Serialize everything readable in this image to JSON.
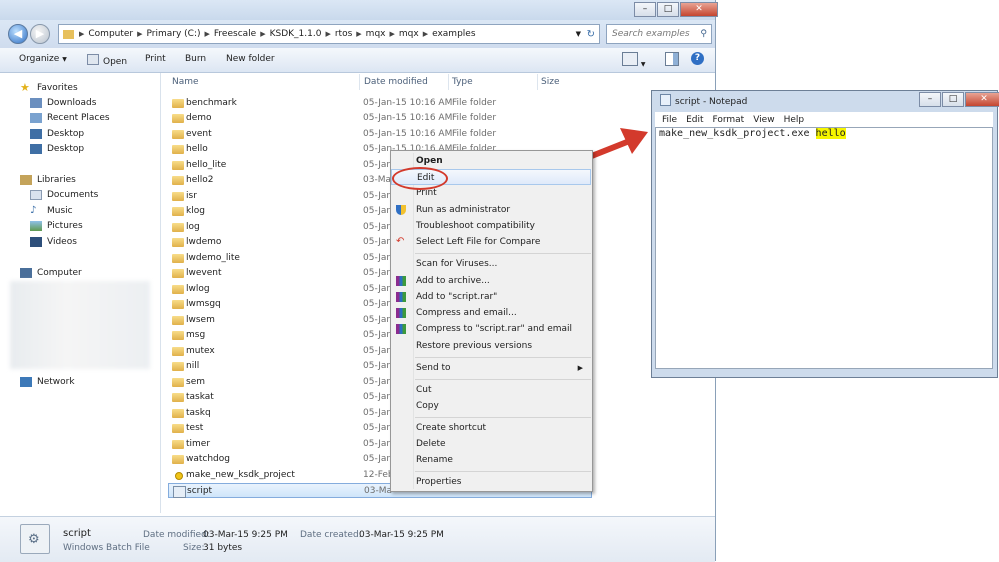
{
  "explorer": {
    "breadcrumb": [
      "Computer",
      "Primary (C:)",
      "Freescale",
      "KSDK_1.1.0",
      "rtos",
      "mqx",
      "mqx",
      "examples"
    ],
    "search_placeholder": "Search examples",
    "toolbar": {
      "organize": "Organize",
      "open": "Open",
      "print": "Print",
      "burn": "Burn",
      "new_folder": "New folder"
    },
    "nav": {
      "favorites": "Favorites",
      "downloads": "Downloads",
      "recent_places": "Recent Places",
      "desktop1": "Desktop",
      "desktop2": "Desktop",
      "libraries": "Libraries",
      "documents": "Documents",
      "music": "Music",
      "pictures": "Pictures",
      "videos": "Videos",
      "computer": "Computer",
      "network": "Network"
    },
    "columns": {
      "name": "Name",
      "date": "Date modified",
      "type": "Type",
      "size": "Size"
    },
    "files": [
      {
        "name": "benchmark",
        "date": "05-Jan-15 10:16 AM",
        "type": "File folder"
      },
      {
        "name": "demo",
        "date": "05-Jan-15 10:16 AM",
        "type": "File folder"
      },
      {
        "name": "event",
        "date": "05-Jan-15 10:16 AM",
        "type": "File folder"
      },
      {
        "name": "hello",
        "date": "05-Jan-15 10:16 AM",
        "type": "File folder"
      },
      {
        "name": "hello_lite",
        "date": "05-Jan",
        "type": ""
      },
      {
        "name": "hello2",
        "date": "03-Ma",
        "type": ""
      },
      {
        "name": "isr",
        "date": "05-Jan",
        "type": ""
      },
      {
        "name": "klog",
        "date": "05-Jan",
        "type": ""
      },
      {
        "name": "log",
        "date": "05-Jan",
        "type": ""
      },
      {
        "name": "lwdemo",
        "date": "05-Jan",
        "type": ""
      },
      {
        "name": "lwdemo_lite",
        "date": "05-Jan",
        "type": ""
      },
      {
        "name": "lwevent",
        "date": "05-Jan",
        "type": ""
      },
      {
        "name": "lwlog",
        "date": "05-Jan",
        "type": ""
      },
      {
        "name": "lwmsgq",
        "date": "05-Jan",
        "type": ""
      },
      {
        "name": "lwsem",
        "date": "05-Jan",
        "type": ""
      },
      {
        "name": "msg",
        "date": "05-Jan",
        "type": ""
      },
      {
        "name": "mutex",
        "date": "05-Jan",
        "type": ""
      },
      {
        "name": "nill",
        "date": "05-Jan",
        "type": ""
      },
      {
        "name": "sem",
        "date": "05-Jan",
        "type": ""
      },
      {
        "name": "taskat",
        "date": "05-Jan",
        "type": ""
      },
      {
        "name": "taskq",
        "date": "05-Jan",
        "type": ""
      },
      {
        "name": "test",
        "date": "05-Jan",
        "type": ""
      },
      {
        "name": "timer",
        "date": "05-Jan",
        "type": ""
      },
      {
        "name": "watchdog",
        "date": "05-Jan",
        "type": ""
      },
      {
        "name": "make_new_ksdk_project",
        "date": "12-Feb",
        "type": ""
      },
      {
        "name": "script",
        "date": "03-Ma",
        "type": ""
      }
    ],
    "status": {
      "name": "script",
      "type": "Windows Batch File",
      "date_modified_label": "Date modified:",
      "date_modified": "03-Mar-15 9:25 PM",
      "date_created_label": "Date created:",
      "date_created": "03-Mar-15 9:25 PM",
      "size_label": "Size:",
      "size": "31 bytes"
    }
  },
  "context_menu": {
    "open": "Open",
    "edit": "Edit",
    "print": "Print",
    "run_as_admin": "Run as administrator",
    "troubleshoot": "Troubleshoot compatibility",
    "select_left": "Select Left File for Compare",
    "scan": "Scan for Viruses...",
    "add_archive": "Add to archive...",
    "add_script_rar": "Add to \"script.rar\"",
    "compress_email": "Compress and email...",
    "compress_script_email": "Compress to \"script.rar\" and email",
    "restore": "Restore previous versions",
    "send_to": "Send to",
    "cut": "Cut",
    "copy": "Copy",
    "create_shortcut": "Create shortcut",
    "delete": "Delete",
    "rename": "Rename",
    "properties": "Properties"
  },
  "notepad": {
    "title": "script - Notepad",
    "menu": [
      "File",
      "Edit",
      "Format",
      "View",
      "Help"
    ],
    "text_plain": "make_new_ksdk_project.exe ",
    "text_highlight": "hello"
  },
  "colors": {
    "annotation_red": "#d33a2c",
    "highlight_yellow": "#f6f600",
    "selection_blue": "#cfe5fa"
  }
}
